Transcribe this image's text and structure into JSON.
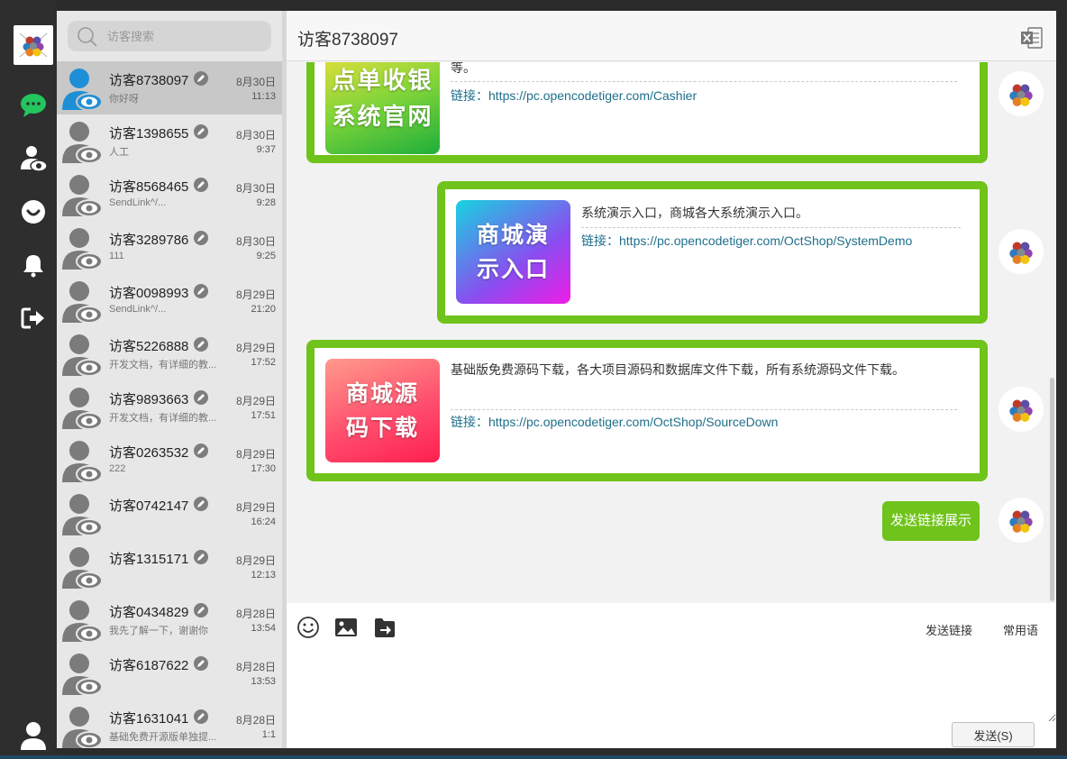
{
  "search": {
    "placeholder": "访客搜索"
  },
  "header": {
    "title": "访客8738097"
  },
  "contacts": [
    {
      "name": "访客8738097",
      "date": "8月30日",
      "time": "11:13",
      "preview": "你好呀"
    },
    {
      "name": "访客1398655",
      "date": "8月30日",
      "time": "9:37",
      "preview": "人工"
    },
    {
      "name": "访客8568465",
      "date": "8月30日",
      "time": "9:28",
      "preview": "SendLink^/..."
    },
    {
      "name": "访客3289786",
      "date": "8月30日",
      "time": "9:25",
      "preview": "111"
    },
    {
      "name": "访客0098993",
      "date": "8月29日",
      "time": "21:20",
      "preview": "SendLink^/..."
    },
    {
      "name": "访客5226888",
      "date": "8月29日",
      "time": "17:52",
      "preview": "开发文档，有详细的教..."
    },
    {
      "name": "访客9893663",
      "date": "8月29日",
      "time": "17:51",
      "preview": "开发文档，有详细的教..."
    },
    {
      "name": "访客0263532",
      "date": "8月29日",
      "time": "17:30",
      "preview": "222"
    },
    {
      "name": "访客0742147",
      "date": "8月29日",
      "time": "16:24",
      "preview": ""
    },
    {
      "name": "访客1315171",
      "date": "8月29日",
      "time": "12:13",
      "preview": ""
    },
    {
      "name": "访客0434829",
      "date": "8月28日",
      "time": "13:54",
      "preview": "我先了解一下，谢谢你"
    },
    {
      "name": "访客6187622",
      "date": "8月28日",
      "time": "13:53",
      "preview": ""
    },
    {
      "name": "访客1631041",
      "date": "8月28日",
      "time": "1:1",
      "preview": "基础免费开源版单独提..."
    }
  ],
  "messages": {
    "card1": {
      "tile": "点单收银系统官网",
      "desc": "等。",
      "link_label": "链接：",
      "link": "https://pc.opencodetiger.com/Cashier"
    },
    "card2": {
      "tile": "商城演示入口",
      "desc": "系统演示入口，商城各大系统演示入口。",
      "link_label": "链接：",
      "link": "https://pc.opencodetiger.com/OctShop/SystemDemo"
    },
    "card3": {
      "tile": "商城源码下载",
      "desc": "基础版免费源码下载，各大项目源码和数据库文件下载，所有系统源码文件下载。",
      "link_label": "链接：",
      "link": "https://pc.opencodetiger.com/OctShop/SourceDown"
    },
    "text1": "发送链接展示"
  },
  "toolbar": {
    "send_link": "发送链接",
    "phrases": "常用语"
  },
  "compose": {
    "send_label": "发送(S)"
  },
  "colors": {
    "accent_green": "#6fc31a",
    "link": "#1f6f8b",
    "rail": "#2e2e2e"
  },
  "icons": [
    "search-icon",
    "chat-icon",
    "visitor-icon",
    "smile-icon",
    "bell-icon",
    "logout-icon",
    "user-icon",
    "excel-icon",
    "emoji-icon",
    "image-icon",
    "file-send-icon",
    "edit-icon"
  ]
}
